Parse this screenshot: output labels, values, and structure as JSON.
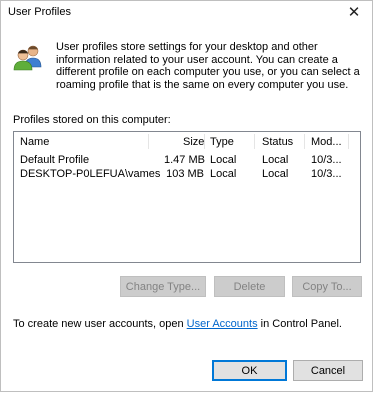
{
  "window": {
    "title": "User Profiles",
    "close_glyph": "✕"
  },
  "intro": {
    "icon": "users-icon",
    "text": "User profiles store settings for your desktop and other information related to your user account. You can create a different profile on each computer you use, or you can select a roaming profile that is the same on every computer you use."
  },
  "profiles": {
    "label": "Profiles stored on this computer:",
    "columns": {
      "name": "Name",
      "size": "Size",
      "type": "Type",
      "status": "Status",
      "modified": "Mod..."
    },
    "rows": [
      {
        "name": "Default Profile",
        "size": "1.47 MB",
        "type": "Local",
        "status": "Local",
        "modified": "10/3..."
      },
      {
        "name": "DESKTOP-P0LEFUA\\vames",
        "size": "103 MB",
        "type": "Local",
        "status": "Local",
        "modified": "10/3..."
      }
    ]
  },
  "actions": {
    "change_type": "Change Type...",
    "delete": "Delete",
    "copy_to": "Copy To..."
  },
  "footer": {
    "prefix": "To create new user accounts, open ",
    "link": "User Accounts",
    "suffix": " in Control Panel."
  },
  "dialog": {
    "ok": "OK",
    "cancel": "Cancel"
  },
  "colors": {
    "link": "#0066cc",
    "default_button_border": "#0078d7",
    "disabled_text": "#838383"
  }
}
